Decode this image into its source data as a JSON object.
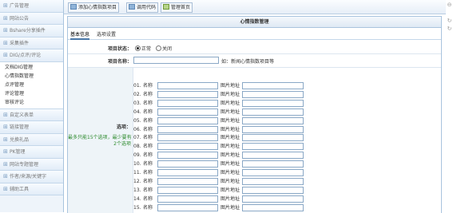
{
  "sidebar": {
    "groups_top": [
      {
        "label": "广告管理"
      },
      {
        "label": "网站公告"
      },
      {
        "label": "Bshare分享插件"
      },
      {
        "label": "采集插件"
      },
      {
        "label": "DIG/点评/评论"
      }
    ],
    "sub_items": [
      {
        "label": "文档DIG管理"
      },
      {
        "label": "心情指数管理"
      },
      {
        "label": "点评管理"
      },
      {
        "label": "评论管理"
      },
      {
        "label": "审核评论"
      }
    ],
    "groups_bottom": [
      {
        "label": "自定义表单"
      },
      {
        "label": "链接管理"
      },
      {
        "label": "兑换礼品"
      },
      {
        "label": "PK管理"
      },
      {
        "label": "网站专题管理"
      },
      {
        "label": "作者/来源/关键字"
      },
      {
        "label": "辅助工具"
      }
    ]
  },
  "toolbar": {
    "add_label": "添加心情指数项目",
    "call_code_label": "调用代码",
    "home_label": "管理首页"
  },
  "panel": {
    "title": "心情指数管理",
    "tabs": [
      "基本信息",
      "选项设置"
    ],
    "status_label": "项目状态：",
    "status_options": [
      "正常",
      "关闭"
    ],
    "status_selected": 0,
    "name_label": "项目名称：",
    "name_value": "",
    "name_hint": "如：新闻心情指数项目等",
    "options_label": "选项：",
    "options_hint_line1": "最多只能15个选项，最少要有",
    "options_hint_line2": "2个选项",
    "options": [
      {
        "num": "01.",
        "name_label": "名称",
        "name": "",
        "img_label": "图片地址",
        "img": ""
      },
      {
        "num": "02.",
        "name_label": "名称",
        "name": "",
        "img_label": "图片地址",
        "img": ""
      },
      {
        "num": "03.",
        "name_label": "名称",
        "name": "",
        "img_label": "图片地址",
        "img": ""
      },
      {
        "num": "04.",
        "name_label": "名称",
        "name": "",
        "img_label": "图片地址",
        "img": ""
      },
      {
        "num": "05.",
        "name_label": "名称",
        "name": "",
        "img_label": "图片地址",
        "img": ""
      },
      {
        "num": "06.",
        "name_label": "名称",
        "name": "",
        "img_label": "图片地址",
        "img": ""
      },
      {
        "num": "07.",
        "name_label": "名称",
        "name": "",
        "img_label": "图片地址",
        "img": ""
      },
      {
        "num": "08.",
        "name_label": "名称",
        "name": "",
        "img_label": "图片地址",
        "img": ""
      },
      {
        "num": "09.",
        "name_label": "名称",
        "name": "",
        "img_label": "图片地址",
        "img": ""
      },
      {
        "num": "10.",
        "name_label": "名称",
        "name": "",
        "img_label": "图片地址",
        "img": ""
      },
      {
        "num": "11.",
        "name_label": "名称",
        "name": "",
        "img_label": "图片地址",
        "img": ""
      },
      {
        "num": "12.",
        "name_label": "名称",
        "name": "",
        "img_label": "图片地址",
        "img": ""
      },
      {
        "num": "13.",
        "name_label": "名称",
        "name": "",
        "img_label": "图片地址",
        "img": ""
      },
      {
        "num": "14.",
        "name_label": "名称",
        "name": "",
        "img_label": "图片地址",
        "img": ""
      },
      {
        "num": "15.",
        "name_label": "名称",
        "name": "",
        "img_label": "图片地址",
        "img": ""
      }
    ]
  },
  "colors": {
    "accent": "#4a78a8",
    "hint_green": "#2e8b2e",
    "sidebar_bg": "#eef4fa"
  }
}
